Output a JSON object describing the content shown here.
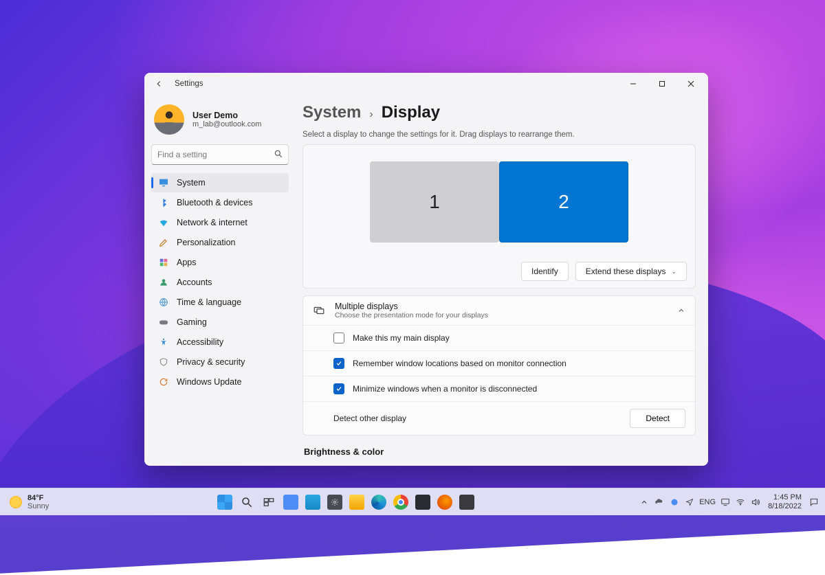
{
  "window": {
    "title": "Settings",
    "account": {
      "name": "User Demo",
      "email": "m_lab@outlook.com"
    },
    "search_placeholder": "Find a setting",
    "nav": [
      {
        "id": "system",
        "label": "System",
        "icon": "monitor",
        "active": true
      },
      {
        "id": "bluetooth",
        "label": "Bluetooth & devices",
        "icon": "bluetooth",
        "active": false
      },
      {
        "id": "network",
        "label": "Network & internet",
        "icon": "wifi",
        "active": false
      },
      {
        "id": "personalization",
        "label": "Personalization",
        "icon": "brush",
        "active": false
      },
      {
        "id": "apps",
        "label": "Apps",
        "icon": "apps",
        "active": false
      },
      {
        "id": "accounts",
        "label": "Accounts",
        "icon": "person",
        "active": false
      },
      {
        "id": "time",
        "label": "Time & language",
        "icon": "globe",
        "active": false
      },
      {
        "id": "gaming",
        "label": "Gaming",
        "icon": "gamepad",
        "active": false
      },
      {
        "id": "accessibility",
        "label": "Accessibility",
        "icon": "accessibility",
        "active": false
      },
      {
        "id": "privacy",
        "label": "Privacy & security",
        "icon": "shield",
        "active": false
      },
      {
        "id": "update",
        "label": "Windows Update",
        "icon": "update",
        "active": false
      }
    ]
  },
  "breadcrumb": {
    "parent": "System",
    "current": "Display"
  },
  "display": {
    "help_text": "Select a display to change the settings for it. Drag displays to rearrange them.",
    "monitors": [
      {
        "label": "1",
        "selected": false
      },
      {
        "label": "2",
        "selected": true
      }
    ],
    "identify_label": "Identify",
    "projection_dropdown": "Extend these displays",
    "multiple_displays": {
      "title": "Multiple displays",
      "description": "Choose the presentation mode for your displays",
      "options": [
        {
          "label": "Make this my main display",
          "checked": false
        },
        {
          "label": "Remember window locations based on monitor connection",
          "checked": true
        },
        {
          "label": "Minimize windows when a monitor is disconnected",
          "checked": true
        }
      ],
      "detect_row_label": "Detect other display",
      "detect_button": "Detect"
    },
    "next_section": "Brightness & color"
  },
  "taskbar": {
    "weather": {
      "temp": "84°F",
      "desc": "Sunny"
    },
    "tray": {
      "lang": "ENG"
    },
    "clock": {
      "time": "1:45 PM",
      "date": "8/18/2022"
    }
  }
}
